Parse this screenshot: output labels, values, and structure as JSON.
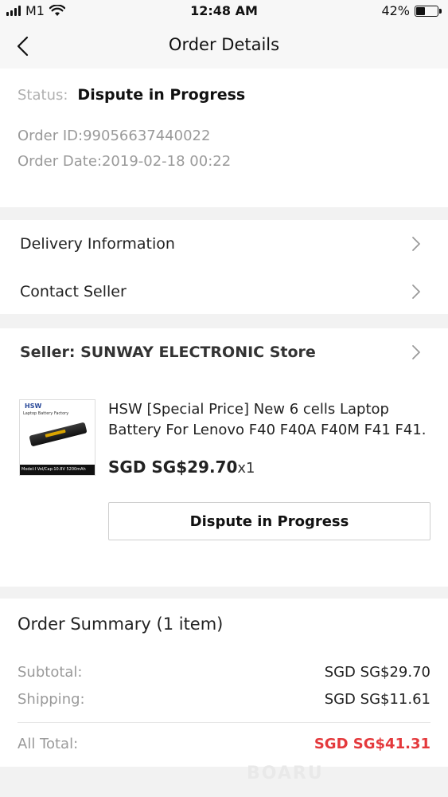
{
  "status_bar": {
    "carrier": "M1",
    "time": "12:48 AM",
    "battery": "42%"
  },
  "nav": {
    "title": "Order Details",
    "back_icon": "chevron-left-icon"
  },
  "order": {
    "status_label": "Status:",
    "status_value": "Dispute in Progress",
    "order_id": "Order ID:99056637440022",
    "order_date": "Order Date:2019-02-18 00:22"
  },
  "links": [
    {
      "label": "Delivery Information"
    },
    {
      "label": "Contact Seller"
    }
  ],
  "seller": {
    "name": "Seller: SUNWAY ELECTRONIC Store"
  },
  "product": {
    "thumb_brand": "HSW",
    "thumb_sub": "Laptop Battery Factory",
    "thumb_footer": "Model:I Vol/Cap:10.8V 5200mAh",
    "title_line1": "HSW [Special Price] New 6 cells Laptop",
    "title_line2": "Battery For Lenovo F40 F40A F40M F41 F41...",
    "price": "SGD SG$29.70",
    "qty": "x1",
    "action_label": "Dispute in Progress"
  },
  "summary": {
    "title": "Order Summary (1 item)",
    "subtotal_label": "Subtotal:",
    "subtotal_value": "SGD SG$29.70",
    "shipping_label": "Shipping:",
    "shipping_value": "SGD SG$11.61",
    "total_label": "All Total:",
    "total_value": "SGD SG$41.31"
  },
  "colors": {
    "total_accent": "#e4393c",
    "background": "#f2f2f2"
  },
  "watermark": "BOARU"
}
